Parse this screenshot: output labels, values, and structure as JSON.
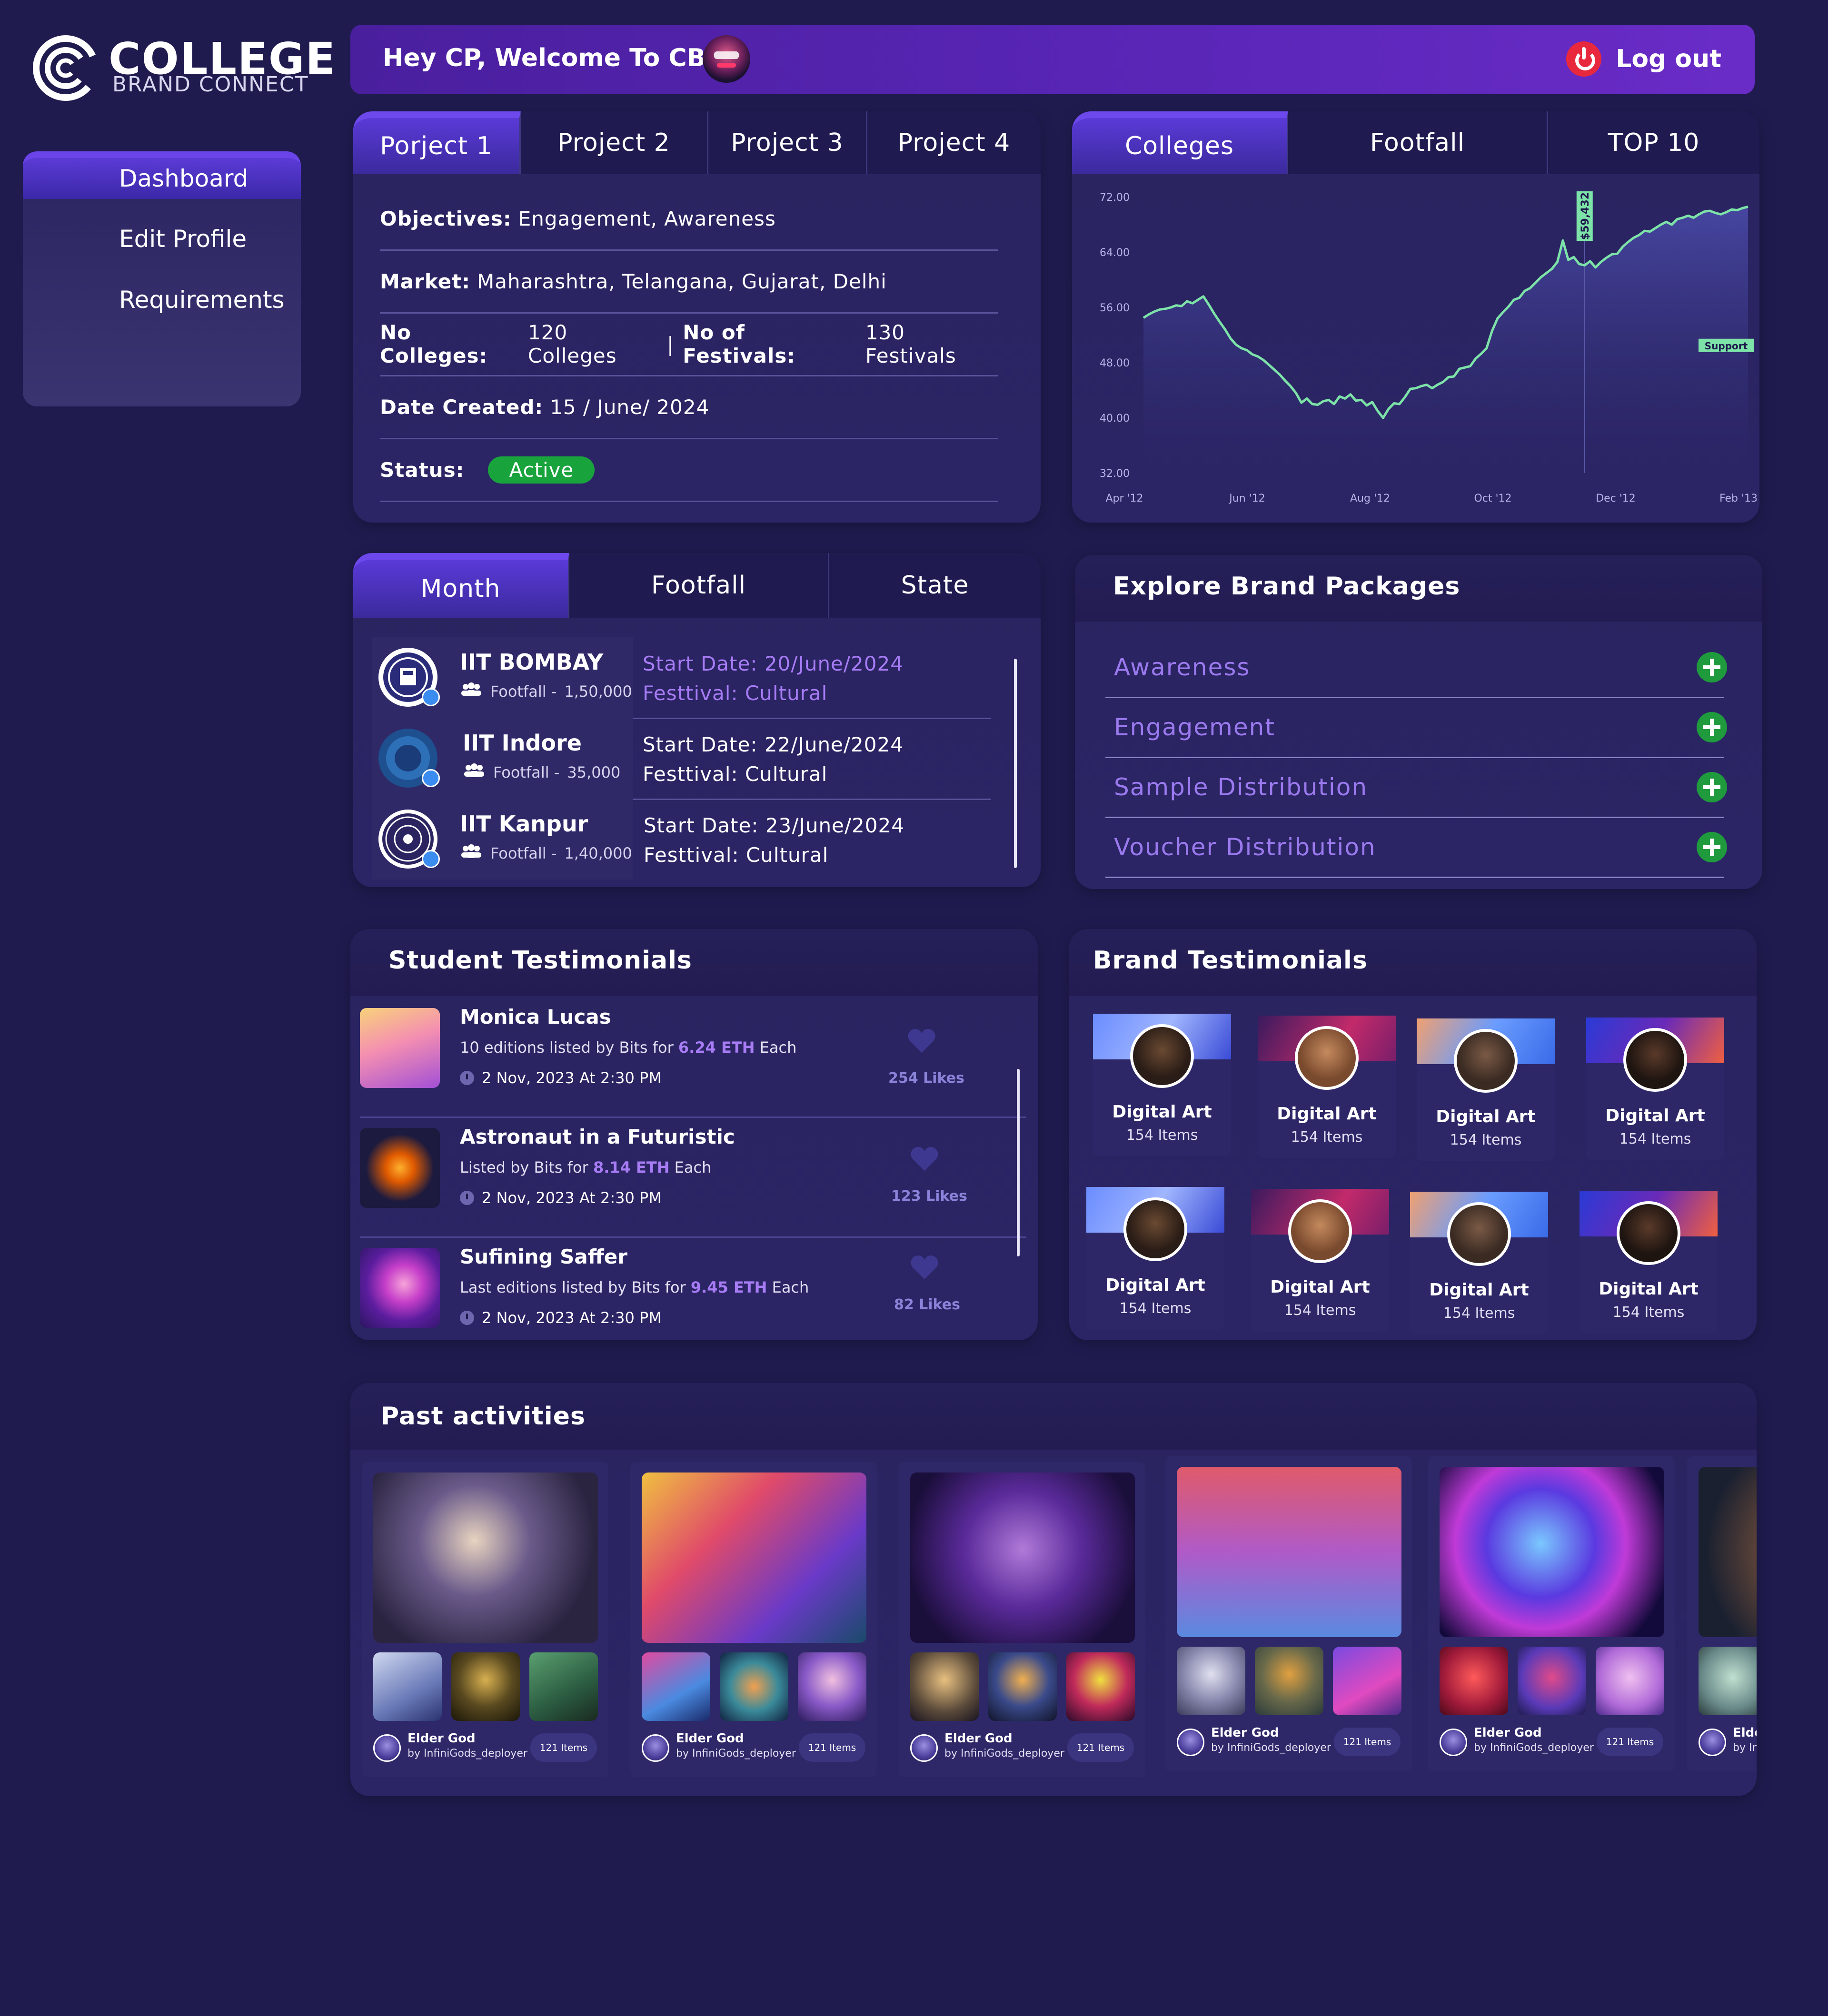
{
  "brand": {
    "line1": "COLLEGE",
    "line2": "BRAND CONNECT"
  },
  "sidebar": {
    "items": [
      {
        "label": "Dashboard",
        "active": true
      },
      {
        "label": "Edit Profile"
      },
      {
        "label": "Requirements"
      }
    ]
  },
  "header": {
    "greeting": "Hey CP, Welcome To CBC",
    "logout_label": "Log out"
  },
  "projects": {
    "tabs": [
      "Porject 1",
      "Project 2",
      "Project 3",
      "Project 4"
    ],
    "objectives_label": "Objectives:",
    "objectives": "Engagement, Awareness",
    "market_label": "Market:",
    "market": "Maharashtra, Telangana, Gujarat, Delhi",
    "colleges_label": "No Colleges:",
    "colleges": "120 Colleges",
    "separator": "|",
    "festivals_label": "No of Festivals:",
    "festivals": "130 Festivals",
    "date_label": "Date Created:",
    "date": "15 / June/ 2024",
    "status_label": "Status:",
    "status": "Active",
    "status_color": "#19a33d"
  },
  "chart_tabs": [
    "Colleges",
    "Footfall",
    "TOP 10"
  ],
  "chart_data": {
    "type": "line",
    "title": "",
    "x_tick_labels": [
      "Apr '12",
      "Jun '12",
      "Aug '12",
      "Oct '12",
      "Dec '12",
      "Feb '13"
    ],
    "y_tick_labels": [
      "72.00",
      "64.00",
      "56.00",
      "48.00",
      "40.00",
      "32.00"
    ],
    "ylim": [
      32,
      72
    ],
    "annotations": {
      "vertical_marker": "$59,432",
      "horizontal_marker": "Support"
    },
    "series": [
      {
        "color": "#7de3a8",
        "x": [
          0,
          2,
          4,
          6,
          8,
          10,
          12,
          14,
          16,
          18,
          20,
          22,
          24,
          26,
          28,
          30,
          32,
          34,
          36,
          38,
          40,
          42,
          44,
          46,
          48,
          50,
          52,
          54,
          56,
          58,
          60,
          62,
          64,
          66,
          68,
          70,
          72,
          74,
          76,
          78,
          80,
          82,
          84,
          86,
          88,
          90,
          92,
          94,
          96,
          98,
          100,
          102,
          104,
          106,
          108,
          110,
          112,
          114,
          116,
          118,
          120,
          122,
          124,
          126,
          128,
          130,
          132,
          134,
          136,
          138,
          140,
          142,
          144,
          146,
          148,
          150,
          152,
          154,
          156,
          158,
          160,
          162,
          164,
          166,
          168,
          170,
          172,
          174,
          176,
          178,
          180,
          182,
          184,
          186,
          188,
          190,
          192,
          194,
          196,
          198,
          200,
          202,
          204,
          206,
          208,
          210,
          212,
          214,
          216,
          218,
          220,
          222
        ],
        "y": [
          54.5,
          55.0,
          55.4,
          55.7,
          55.8,
          56.0,
          56.3,
          56.2,
          56.9,
          56.6,
          57.1,
          57.6,
          56.4,
          55.1,
          53.9,
          52.8,
          51.5,
          50.6,
          50.1,
          49.8,
          49.2,
          48.9,
          48.4,
          47.7,
          47.0,
          46.3,
          45.4,
          44.6,
          43.6,
          42.2,
          42.8,
          42.0,
          41.9,
          42.4,
          42.6,
          42.0,
          43.1,
          42.8,
          43.4,
          42.5,
          42.6,
          41.8,
          42.3,
          41.0,
          40.0,
          41.3,
          42.1,
          42.0,
          43.0,
          44.2,
          44.3,
          44.6,
          44.8,
          44.3,
          44.8,
          45.2,
          45.9,
          46.0,
          47.1,
          47.3,
          47.5,
          48.6,
          49.3,
          50.1,
          52.6,
          54.4,
          55.3,
          56.1,
          57.1,
          57.4,
          58.4,
          58.8,
          59.6,
          60.4,
          61.0,
          61.6,
          62.6,
          65.7,
          62.9,
          63.3,
          62.3,
          62.1,
          62.7,
          61.8,
          62.6,
          63.2,
          63.7,
          63.8,
          64.8,
          65.5,
          66.1,
          66.5,
          67.1,
          67.0,
          67.5,
          68.0,
          68.4,
          68.0,
          68.8,
          69.0,
          69.3,
          69.0,
          69.5,
          69.9,
          70.0,
          69.7,
          69.5,
          69.8,
          70.2,
          70.1,
          70.4,
          70.6
        ]
      }
    ],
    "grid": false
  },
  "months": {
    "tabs": [
      "Month",
      "Footfall",
      "State"
    ],
    "rows": [
      {
        "name": "IIT BOMBAY",
        "footfall_label": "Footfall -",
        "footfall": "1,50,000",
        "start": "Start Date: 20/June/2024",
        "fest": "Festtival: Cultural",
        "highlight": true
      },
      {
        "name": "IIT Indore",
        "footfall_label": "Footfall -",
        "footfall": "35,000",
        "start": "Start Date: 22/June/2024",
        "fest": "Festtival: Cultural",
        "highlight": false
      },
      {
        "name": "IIT Kanpur",
        "footfall_label": "Footfall -",
        "footfall": "1,40,000",
        "start": "Start Date: 23/June/2024",
        "fest": "Festtival: Cultural",
        "highlight": false
      }
    ]
  },
  "explore": {
    "title": "Explore Brand Packages",
    "packages": [
      "Awareness",
      "Engagement",
      "Sample Distribution",
      "Voucher Distribution"
    ]
  },
  "student_testimonials": {
    "title": "Student Testimonials",
    "items": [
      {
        "title": "Monica Lucas",
        "desc_pre": "10 editions listed by Bits for ",
        "eth": "6.24 ETH",
        "desc_post": " Each",
        "date": "2 Nov, 2023 At 2:30 PM",
        "likes": "254 Likes"
      },
      {
        "title": "Astronaut in a Futuristic",
        "desc_pre": "Listed by Bits for ",
        "eth": "8.14 ETH",
        "desc_post": " Each",
        "date": "2 Nov, 2023 At 2:30 PM",
        "likes": "123 Likes"
      },
      {
        "title": "Sufining Saffer",
        "desc_pre": "Last editions listed by Bits for ",
        "eth": "9.45 ETH",
        "desc_post": " Each",
        "date": "2 Nov, 2023 At 2:30 PM",
        "likes": "82 Likes"
      }
    ]
  },
  "brand_testimonials": {
    "title": "Brand Testimonials",
    "items": [
      {
        "name": "Digital Art",
        "items": "154 Items"
      },
      {
        "name": "Digital Art",
        "items": "154 Items"
      },
      {
        "name": "Digital Art",
        "items": "154 Items"
      },
      {
        "name": "Digital Art",
        "items": "154 Items"
      },
      {
        "name": "Digital Art",
        "items": "154 Items"
      },
      {
        "name": "Digital Art",
        "items": "154 Items"
      },
      {
        "name": "Digital Art",
        "items": "154 Items"
      },
      {
        "name": "Digital Art",
        "items": "154 Items"
      }
    ]
  },
  "past_activities": {
    "title": "Past activities",
    "cards": [
      {
        "name": "Elder God",
        "by": "by InfiniGods_deployer",
        "items": "121 Items"
      },
      {
        "name": "Elder God",
        "by": "by InfiniGods_deployer",
        "items": "121 Items"
      },
      {
        "name": "Elder God",
        "by": "by InfiniGods_deployer",
        "items": "121 Items"
      },
      {
        "name": "Elder God",
        "by": "by InfiniGods_deployer",
        "items": "121 Items"
      },
      {
        "name": "Elder God",
        "by": "by InfiniGods_deployer",
        "items": "121 Items"
      },
      {
        "name": "Elder",
        "by": "by Infi",
        "items": ""
      }
    ]
  }
}
